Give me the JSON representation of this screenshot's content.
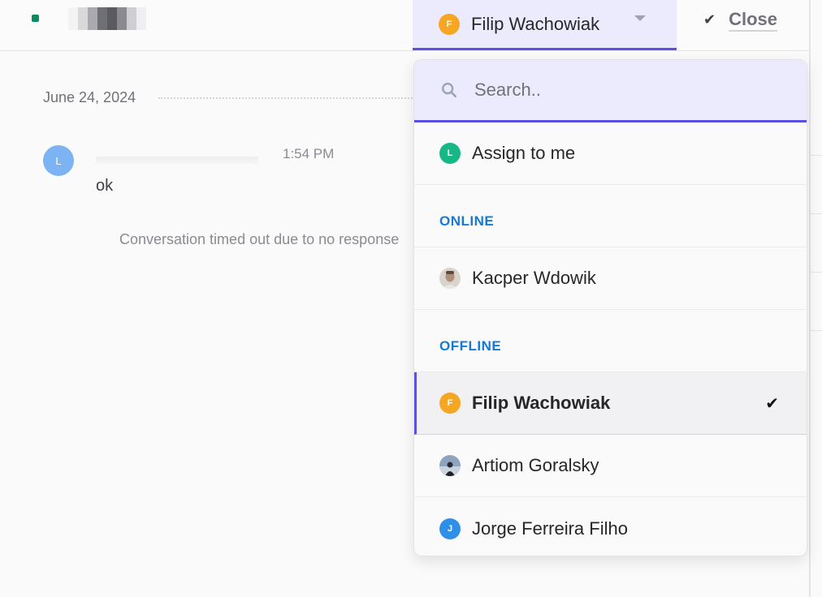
{
  "header": {
    "assignee": {
      "initial": "F",
      "name": "Filip Wachowiak",
      "avatar_color": "#f5a623"
    },
    "close_label": "Close",
    "close_icon": "check-icon",
    "dropdown_icon": "caret-down-icon",
    "status_color": "#0f8a5f"
  },
  "conversation": {
    "date": "June 24, 2024",
    "message": {
      "avatar_initial": "L",
      "avatar_color": "#7cb3f2",
      "time": "1:54 PM",
      "text": "ok"
    },
    "system_note": "Conversation timed out due to no response"
  },
  "dropdown": {
    "search": {
      "placeholder": "Search..",
      "icon": "search-icon"
    },
    "assign_to_me": {
      "initial": "L",
      "label": "Assign to me",
      "avatar_color": "#16b886"
    },
    "sections": {
      "online": "ONLINE",
      "offline": "OFFLINE"
    },
    "online_agents": [
      {
        "name": "Kacper Wdowik",
        "avatar": "photo"
      }
    ],
    "offline_agents": [
      {
        "name": "Filip Wachowiak",
        "initial": "F",
        "avatar_color": "#f5a623",
        "selected": true
      },
      {
        "name": "Artiom Goralsky",
        "avatar": "photo"
      },
      {
        "name": "Jorge Ferreira Filho",
        "initial": "J",
        "avatar_color": "#2f8fe8"
      }
    ]
  },
  "colors": {
    "accent": "#5b4fe0",
    "accent_bg": "#ecebfd",
    "section_label": "#1479d8"
  }
}
